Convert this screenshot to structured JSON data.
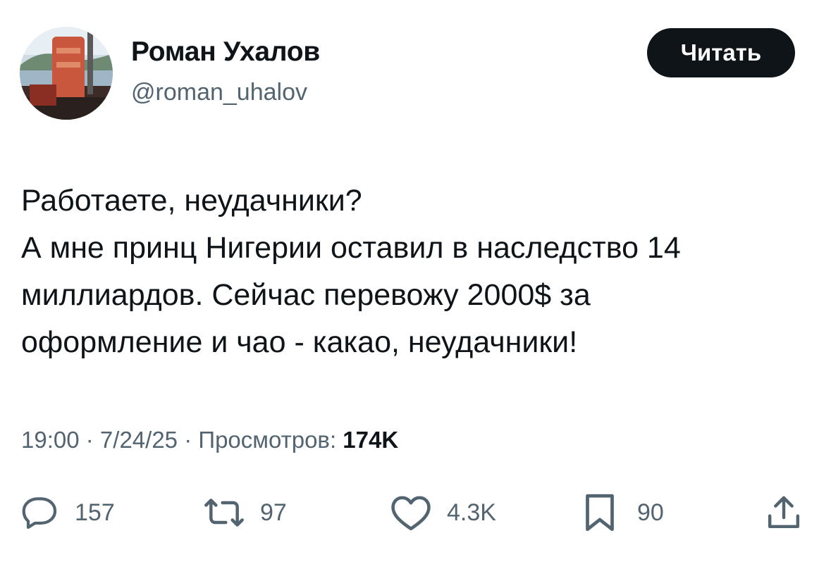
{
  "author": {
    "name": "Роман Ухалов",
    "handle": "@roman_uhalov"
  },
  "follow_button": {
    "label": "Читать"
  },
  "tweet": {
    "lines": [
      "Работаете, неудачники?",
      "А мне принц Нигерии оставил в наследство 14",
      "миллиардов. Сейчас перевожу 2000$ за",
      "оформление и чао - какао, неудачники!"
    ]
  },
  "meta": {
    "time": "19:00",
    "sep": " · ",
    "date": "7/24/25",
    "views_label": "Просмотров: ",
    "views": "174K"
  },
  "actions": {
    "replies": {
      "icon": "reply-icon",
      "count": "157"
    },
    "reposts": {
      "icon": "repost-icon",
      "count": "97"
    },
    "likes": {
      "icon": "heart-icon",
      "count": "4.3K"
    },
    "bookmarks": {
      "icon": "bookmark-icon",
      "count": "90"
    },
    "share": {
      "icon": "share-icon"
    }
  },
  "colors": {
    "text": "#0f1419",
    "secondary": "#536471",
    "button_bg": "#0f1419",
    "button_text": "#ffffff"
  }
}
